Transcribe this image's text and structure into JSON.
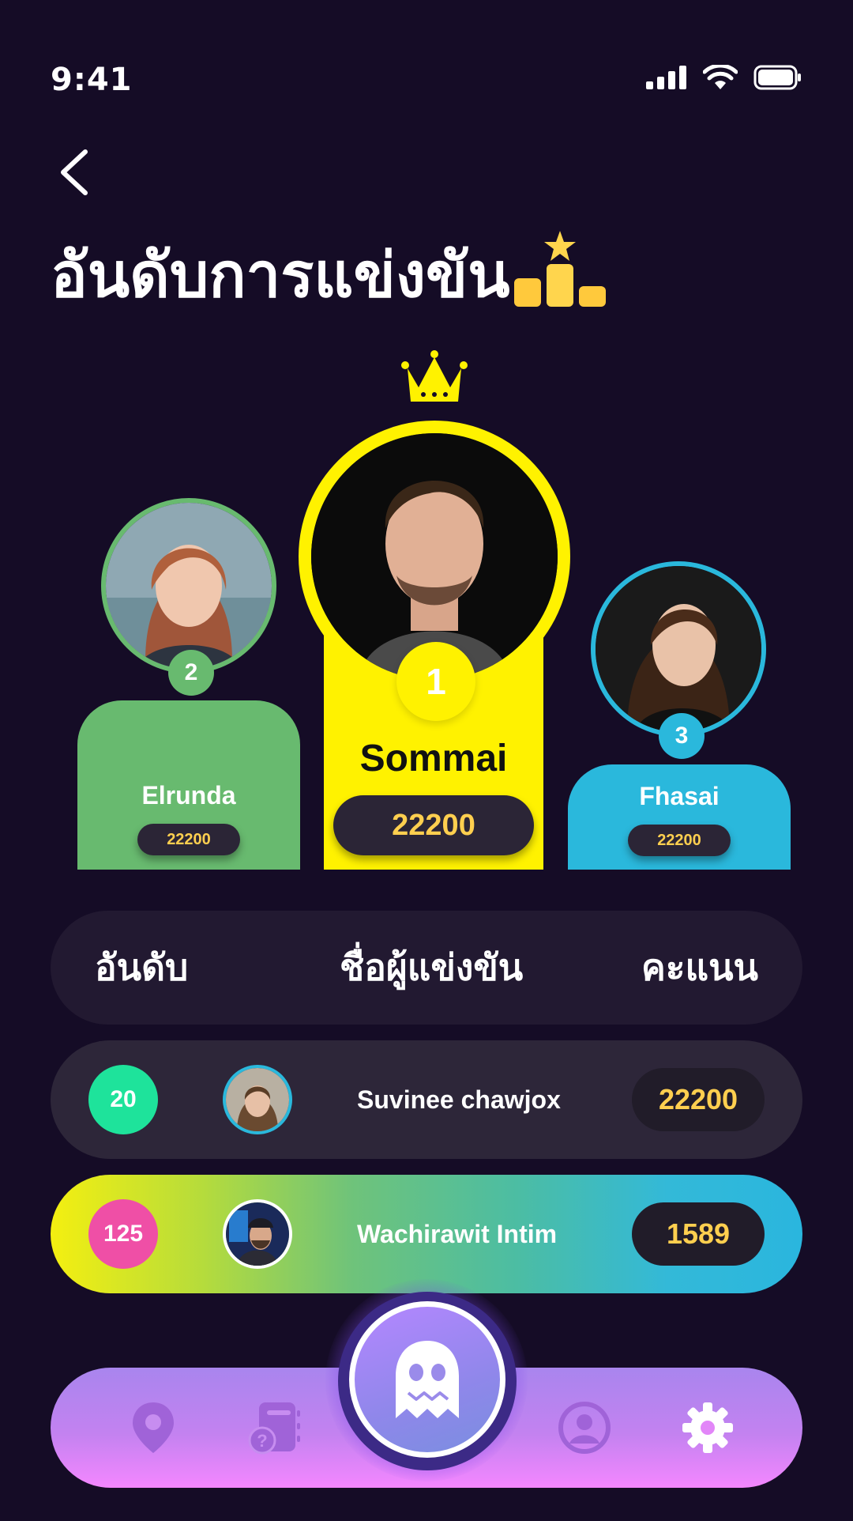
{
  "status": {
    "time": "9:41"
  },
  "page": {
    "title": "อันดับการแข่งขัน"
  },
  "podium": {
    "first": {
      "rank": "1",
      "name": "Sommai",
      "score": "22200"
    },
    "second": {
      "rank": "2",
      "name": "Elrunda",
      "score": "22200"
    },
    "third": {
      "rank": "3",
      "name": "Fhasai",
      "score": "22200"
    }
  },
  "table": {
    "headers": {
      "rank": "อันดับ",
      "name": "ชื่อผู้แข่งขัน",
      "score": "คะแนน"
    },
    "rows": [
      {
        "rank": "20",
        "name": "Suvinee chawjox",
        "score": "22200",
        "rank_color": "#1ee39b"
      },
      {
        "rank": "125",
        "name": "Wachirawit Intim",
        "score": "1589",
        "rank_color": "#ef4fa6"
      }
    ]
  },
  "nav": {
    "items": [
      "location-icon",
      "quiz-book-icon",
      "ghost-icon",
      "profile-icon",
      "settings-icon"
    ]
  },
  "colors": {
    "background": "#150c26",
    "gold": "#fff200",
    "green": "#68ba6f",
    "blue": "#2ab8dc",
    "score_text": "#ffcf4f"
  }
}
